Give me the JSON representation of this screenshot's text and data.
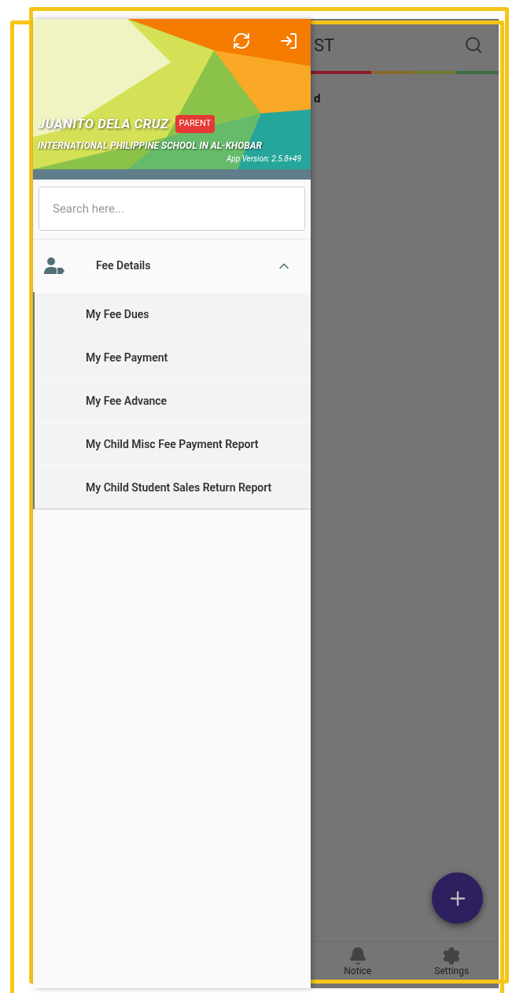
{
  "app": {
    "title_fragment": "ST",
    "content_fragment": "d",
    "nav": [
      {
        "kind": "notice",
        "label": "Notice"
      },
      {
        "kind": "settings",
        "label": "Settings"
      }
    ]
  },
  "drawer": {
    "user_name": "JUANITO DELA CRUZ",
    "role_badge": "PARENT",
    "school": "INTERNATIONAL PHILIPPINE SCHOOL IN AL-KHOBAR",
    "app_version": "App Version: 2.5.8+49",
    "search": {
      "placeholder": "Search here..."
    },
    "menu": [
      {
        "label": "Fee Details",
        "expanded": true,
        "children": [
          {
            "label": "My Fee Dues"
          },
          {
            "label": "My Fee Payment"
          },
          {
            "label": "My Fee Advance"
          },
          {
            "label": "My Child Misc Fee Payment Report"
          },
          {
            "label": "My Child Student Sales Return Report"
          }
        ]
      }
    ]
  }
}
